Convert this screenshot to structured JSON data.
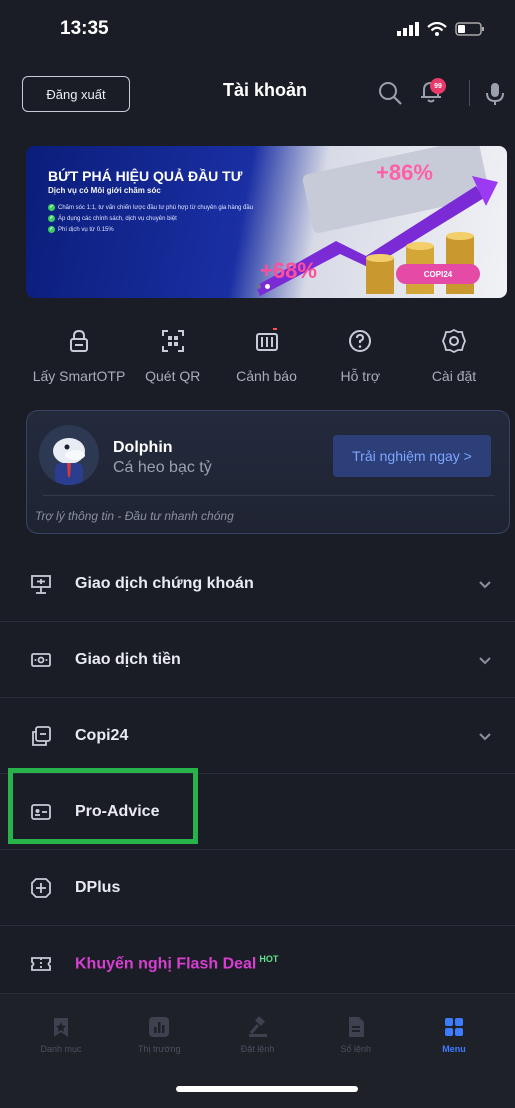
{
  "status_bar": {
    "time": "13:35"
  },
  "header": {
    "logout_label": "Đăng xuất",
    "title": "Tài khoản",
    "notification_badge": "99"
  },
  "banner": {
    "title": "BỨT PHÁ HIỆU QUẢ ĐẦU TƯ",
    "subtitle": "Dịch vụ có Môi giới chăm sóc",
    "bullets": [
      "Chăm sóc 1:1, tư vấn chiến lược đầu tư phù hợp từ chuyên gia hàng đầu",
      "Áp dụng các chính sách, dịch vụ chuyên biệt",
      "Phí dịch vụ từ 0.15%"
    ],
    "percent_top": "+86%",
    "percent_bottom": "+68%",
    "tag": "COPI24"
  },
  "quick_actions": [
    {
      "label": "Lấy SmartOTP",
      "icon": "lock-icon"
    },
    {
      "label": "Quét QR",
      "icon": "qr-scan-icon"
    },
    {
      "label": "Cảnh báo",
      "icon": "alert-calendar-icon"
    },
    {
      "label": "Hỗ trợ",
      "icon": "help-icon"
    },
    {
      "label": "Cài đặt",
      "icon": "gear-icon"
    }
  ],
  "dolphin_card": {
    "name": "Dolphin",
    "subtitle": "Cá heo bạc tỷ",
    "button": "Trải nghiệm ngay >",
    "footer": "Trợ lý thông tin - Đầu tư nhanh chóng"
  },
  "menu": [
    {
      "label": "Giao dịch chứng khoán",
      "icon": "presentation-icon",
      "expandable": true
    },
    {
      "label": "Giao dịch tiền",
      "icon": "cash-icon",
      "expandable": true
    },
    {
      "label": "Copi24",
      "icon": "copy-icon",
      "expandable": true
    },
    {
      "label": "Pro-Advice",
      "icon": "id-card-icon",
      "expandable": false
    },
    {
      "label": "DPlus",
      "icon": "dplus-icon",
      "expandable": false
    },
    {
      "label": "Khuyến nghị Flash Deal",
      "icon": "ticket-icon",
      "expandable": false,
      "badge": "HOT"
    }
  ],
  "bottom_nav": [
    {
      "label": "Danh mục",
      "icon": "bookmark-icon",
      "active": false
    },
    {
      "label": "Thị trường",
      "icon": "market-chart-icon",
      "active": false
    },
    {
      "label": "Đặt lệnh",
      "icon": "gavel-icon",
      "active": false
    },
    {
      "label": "Sổ lệnh",
      "icon": "order-book-icon",
      "active": false
    },
    {
      "label": "Menu",
      "icon": "grid-menu-icon",
      "active": true
    }
  ],
  "colors": {
    "background": "#1b1d26",
    "accent": "#3d7bff",
    "highlight": "#27b34a",
    "flash_deal": "#d63fd0"
  }
}
